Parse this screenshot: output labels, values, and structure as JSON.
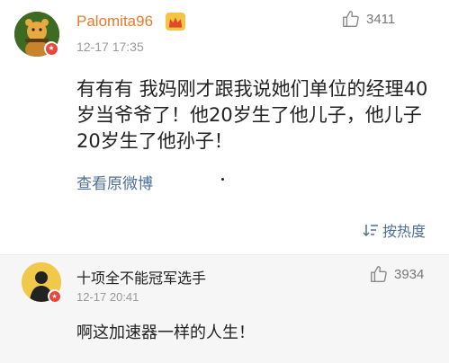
{
  "comment": {
    "username": "Palomita96",
    "timestamp": "12-17 17:35",
    "like_count": "3411",
    "content": "有有有 我妈刚才跟我说她们单位的经理40岁当爷爷了！他20岁生了他儿子，他儿子20岁生了他孙子！",
    "view_original": "查看原微博"
  },
  "sort": {
    "label": "按热度"
  },
  "reply": {
    "username": "十项全不能冠军选手",
    "timestamp": "12-17 20:41",
    "like_count": "3934",
    "text": "啊这加速器一样的人生！"
  },
  "colors": {
    "username": "#e87a2a",
    "link": "#4d6f9a",
    "muted": "#999999",
    "badge": "#e8473e",
    "crown": "#f4c545",
    "reply_bg": "#f6f6f6"
  },
  "icons": {
    "like": "thumbs-up-icon",
    "sort": "sort-icon",
    "crown": "crown-icon",
    "badge": "verified-badge-icon"
  }
}
